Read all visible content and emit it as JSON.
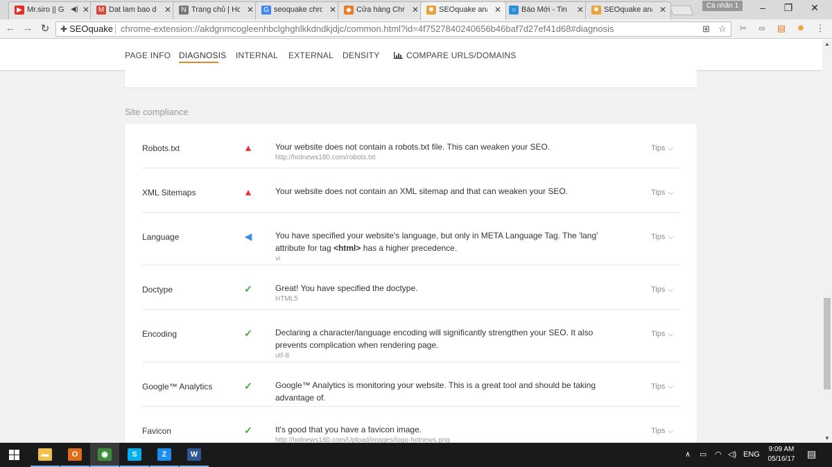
{
  "browser": {
    "tabs": [
      {
        "title": "Mr.siro || G",
        "icon": "youtube-icon",
        "color": "#e52d27",
        "glyph": "▶",
        "audio": true
      },
      {
        "title": "Dat lam bao d",
        "icon": "gmail-icon",
        "color": "#d44638",
        "glyph": "M"
      },
      {
        "title": "Trang chủ | Ho",
        "icon": "news-site-icon",
        "color": "#777777",
        "glyph": "N"
      },
      {
        "title": "seoquake chro",
        "icon": "google-icon",
        "color": "#4285f4",
        "glyph": "G"
      },
      {
        "title": "Cửa hàng Chr",
        "icon": "chrome-store-icon",
        "color": "#e57d2a",
        "glyph": "◆"
      },
      {
        "title": "SEOquake ana",
        "icon": "seoquake-icon",
        "color": "#e8a33a",
        "glyph": "✹",
        "active": true
      },
      {
        "title": "Báo Mới - Tin",
        "icon": "baomoi-icon",
        "color": "#2b8fd6",
        "glyph": "○"
      },
      {
        "title": "SEOquake ana",
        "icon": "seoquake-icon",
        "color": "#e8a33a",
        "glyph": "✹"
      }
    ],
    "profile_label": "Cá nhân 1",
    "omnibox": {
      "extension_name": "SEOquake",
      "url": "chrome-extension://akdgnmcogleenhbclghghlkkdndkjdjc/common.html?id=4f7527840240656b46baf7d27ef41d68#diagnosis"
    }
  },
  "nav": {
    "items": [
      "PAGE INFO",
      "DIAGNOSIS",
      "INTERNAL",
      "EXTERNAL",
      "DENSITY",
      "COMPARE URLS/DOMAINS"
    ],
    "active": "DIAGNOSIS",
    "accent_color": "#e8842a"
  },
  "section": {
    "title": "Site compliance",
    "tips_label": "Tips",
    "rows": [
      {
        "name": "Robots.txt",
        "status": "warning",
        "message": "Your website does not contain a robots.txt file. This can weaken your SEO.",
        "detail": "http://hotnews180.com/robots.txt"
      },
      {
        "name": "XML Sitemaps",
        "status": "warning",
        "message": "Your website does not contain an XML sitemap and that can weaken your SEO.",
        "detail": ""
      },
      {
        "name": "Language",
        "status": "info",
        "message_pre": "You have specified your website's language, but only in META Language Tag. The 'lang' attribute for tag ",
        "message_bold": "<html>",
        "message_post": " has a higher precedence.",
        "detail": "vi"
      },
      {
        "name": "Doctype",
        "status": "ok",
        "message": "Great! You have specified the doctype.",
        "detail": "HTML5"
      },
      {
        "name": "Encoding",
        "status": "ok",
        "message": "Declaring a character/language encoding will significantly strengthen your SEO. It also prevents complication when rendering page.",
        "detail": "utf-8"
      },
      {
        "name": "Google™ Analytics",
        "status": "ok",
        "message": "Google™ Analytics is monitoring your website. This is a great tool and should be taking advantage of.",
        "detail": ""
      },
      {
        "name": "Favicon",
        "status": "ok",
        "message": "It's good that you have a favicon image.",
        "detail": "http://hotnews180.com/Upload/images/logo-hotnews.png"
      }
    ]
  },
  "taskbar": {
    "apps": [
      {
        "icon": "file-explorer-icon",
        "color": "#f0c24a",
        "glyph": "▬"
      },
      {
        "icon": "outlook-icon",
        "color": "#e26a1b",
        "glyph": "O"
      },
      {
        "icon": "chrome-icon",
        "color": "#3b8d3b",
        "glyph": "◉",
        "active": true
      },
      {
        "icon": "skype-icon",
        "color": "#00aff0",
        "glyph": "S"
      },
      {
        "icon": "zalo-icon",
        "color": "#1a8df2",
        "glyph": "Z"
      },
      {
        "icon": "word-icon",
        "color": "#2b5797",
        "glyph": "W"
      }
    ],
    "language": "ENG",
    "time": "9:09 AM",
    "date": "05/16/17"
  }
}
